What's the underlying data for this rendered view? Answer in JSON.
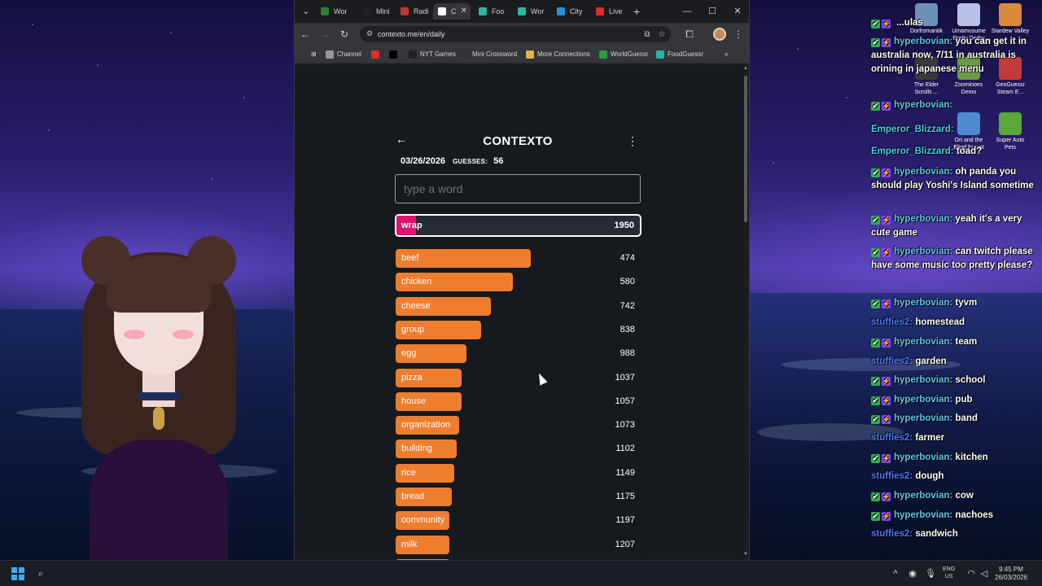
{
  "browser": {
    "tabs": [
      {
        "label": "Wor",
        "favicon_color": "#2f7d32"
      },
      {
        "label": "Mini",
        "favicon_color": "#222222"
      },
      {
        "label": "Radi",
        "favicon_color": "#c0392b"
      },
      {
        "label": "C",
        "favicon_color": "#ffffff"
      },
      {
        "label": "Foo",
        "favicon_color": "#2bb5a5"
      },
      {
        "label": "Wor",
        "favicon_color": "#2bb5a5"
      },
      {
        "label": "City",
        "favicon_color": "#2b8fd6"
      },
      {
        "label": "Live",
        "favicon_color": "#e02b2b"
      }
    ],
    "url": "contexto.me/en/daily",
    "bookmarks": [
      {
        "label": "Channel",
        "favicon_color": "#999999"
      },
      {
        "label": "",
        "favicon_color": "#e02b2b"
      },
      {
        "label": "",
        "favicon_color": "#000000"
      },
      {
        "label": "NYT Games",
        "favicon_color": "#222222"
      },
      {
        "label": "Mini Crossword",
        "favicon_color": "#333333"
      },
      {
        "label": "More Connections",
        "favicon_color": "#e0b64a"
      },
      {
        "label": "WorldGuessr",
        "favicon_color": "#2f9b3f"
      },
      {
        "label": "FoodGuessr",
        "favicon_color": "#2bb5a5"
      }
    ]
  },
  "app": {
    "title": "CONTEXTO",
    "date": "03/26/2026",
    "guesses_label": "GUESSES:",
    "guesses_count": "56",
    "input_placeholder": "type a word",
    "current_guess": {
      "word": "wrap",
      "rank": "1950",
      "fill_pct": 8
    },
    "guesses": [
      {
        "word": "beef",
        "rank": "474",
        "fill_pct": 55
      },
      {
        "word": "chicken",
        "rank": "580",
        "fill_pct": 48
      },
      {
        "word": "cheese",
        "rank": "742",
        "fill_pct": 39
      },
      {
        "word": "group",
        "rank": "838",
        "fill_pct": 35
      },
      {
        "word": "egg",
        "rank": "988",
        "fill_pct": 29
      },
      {
        "word": "pizza",
        "rank": "1037",
        "fill_pct": 27
      },
      {
        "word": "house",
        "rank": "1057",
        "fill_pct": 27
      },
      {
        "word": "organization",
        "rank": "1073",
        "fill_pct": 26
      },
      {
        "word": "building",
        "rank": "1102",
        "fill_pct": 25
      },
      {
        "word": "rice",
        "rank": "1149",
        "fill_pct": 24
      },
      {
        "word": "bread",
        "rank": "1175",
        "fill_pct": 23
      },
      {
        "word": "community",
        "rank": "1197",
        "fill_pct": 22
      },
      {
        "word": "milk",
        "rank": "1207",
        "fill_pct": 22
      }
    ],
    "colors": {
      "close": "#ef7d2e",
      "far": "#e0136e"
    }
  },
  "desktop_icons": [
    {
      "label": "Dorfromantik",
      "color": "#6e8fb8"
    },
    {
      "label": "Umamusume Pretty Derby",
      "color": "#b7c0e6"
    },
    {
      "label": "Stardew Valley",
      "color": "#d98a3a"
    },
    {
      "label": "The Elder Scrolls ...",
      "color": "#3a3a3a"
    },
    {
      "label": "Zoominoes Demo",
      "color": "#6c9a44"
    },
    {
      "label": "GeoGuessr Steam E...",
      "color": "#c23b3b"
    },
    {
      "label": "Ori and the Blind Forest",
      "color": "#4d8ad0"
    },
    {
      "label": "Super Auto Pets",
      "color": "#5aa83c"
    }
  ],
  "chat": [
    {
      "user": "",
      "user_class": "u-hyper",
      "badges": true,
      "text": "...ulas"
    },
    {
      "user": "hyperbovian:",
      "user_class": "u-hyper",
      "badges": true,
      "text": "you can get it in australia now, 7/11 in australia is orining in japanese menu"
    },
    {
      "user": "hyperbovian:",
      "user_class": "u-hyper",
      "badges": true,
      "text": ""
    },
    {
      "user": "Emperor_Blizzard:",
      "user_class": "u-emp",
      "badges": false,
      "text": ""
    },
    {
      "user": "Emperor_Blizzard:",
      "user_class": "u-emp",
      "badges": false,
      "text": "toad?"
    },
    {
      "user": "hyperbovian:",
      "user_class": "u-hyper",
      "badges": true,
      "text": "oh panda you should play Yoshi's Island sometime"
    },
    {
      "user": "hyperbovian:",
      "user_class": "u-hyper",
      "badges": true,
      "text": "yeah it's a very cute game"
    },
    {
      "user": "hyperbovian:",
      "user_class": "u-hyper",
      "badges": true,
      "text": "can twitch please have some music too pretty please?"
    },
    {
      "user": "hyperbovian:",
      "user_class": "u-hyper",
      "badges": true,
      "text": "tyvm"
    },
    {
      "user": "stuffies2:",
      "user_class": "u-stuff",
      "badges": false,
      "text": "homestead"
    },
    {
      "user": "hyperbovian:",
      "user_class": "u-hyper",
      "badges": true,
      "text": "team"
    },
    {
      "user": "stuffies2:",
      "user_class": "u-stuff",
      "badges": false,
      "text": "garden"
    },
    {
      "user": "hyperbovian:",
      "user_class": "u-hyper",
      "badges": true,
      "text": "school"
    },
    {
      "user": "hyperbovian:",
      "user_class": "u-hyper",
      "badges": true,
      "text": "pub"
    },
    {
      "user": "hyperbovian:",
      "user_class": "u-hyper",
      "badges": true,
      "text": "band"
    },
    {
      "user": "stuffies2:",
      "user_class": "u-stuff",
      "badges": false,
      "text": "farmer"
    },
    {
      "user": "hyperbovian:",
      "user_class": "u-hyper",
      "badges": true,
      "text": "kitchen"
    },
    {
      "user": "stuffies2:",
      "user_class": "u-stuff",
      "badges": false,
      "text": "dough"
    },
    {
      "user": "hyperbovian:",
      "user_class": "u-hyper",
      "badges": true,
      "text": "cow"
    },
    {
      "user": "hyperbovian:",
      "user_class": "u-hyper",
      "badges": true,
      "text": "nachoes"
    },
    {
      "user": "stuffies2:",
      "user_class": "u-stuff",
      "badges": false,
      "text": "sandwich"
    }
  ],
  "taskbar": {
    "lang_line1": "ENG",
    "lang_line2": "US",
    "time": "9:45 PM",
    "date": "26/03/2026"
  }
}
